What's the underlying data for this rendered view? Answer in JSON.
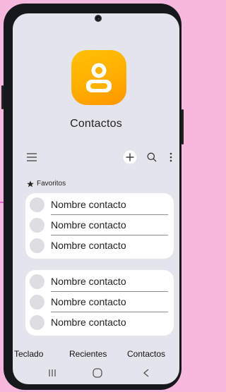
{
  "app": {
    "title": "Contactos"
  },
  "toolbar": {
    "icons": [
      "menu-icon",
      "add-icon",
      "search-icon",
      "more-vertical-icon"
    ]
  },
  "favorites": {
    "label": "Favoritos",
    "contacts": [
      {
        "name": "Nombre contacto"
      },
      {
        "name": "Nombre contacto"
      },
      {
        "name": "Nombre contacto"
      }
    ]
  },
  "contacts": [
    {
      "name": "Nombre contacto"
    },
    {
      "name": "Nombre contacto"
    },
    {
      "name": "Nombre contacto"
    }
  ],
  "tabs": [
    {
      "label": "Teclado"
    },
    {
      "label": "Recientes"
    },
    {
      "label": "Contactos"
    }
  ],
  "navbar": {
    "icons": [
      "recent-apps-icon",
      "home-icon",
      "back-icon"
    ]
  },
  "colors": {
    "background": "#f7b8de",
    "screen": "#e4e4ec",
    "accent_start": "#ffc107",
    "accent_end": "#ff9500",
    "annotation_arrow": "#e040c8"
  }
}
